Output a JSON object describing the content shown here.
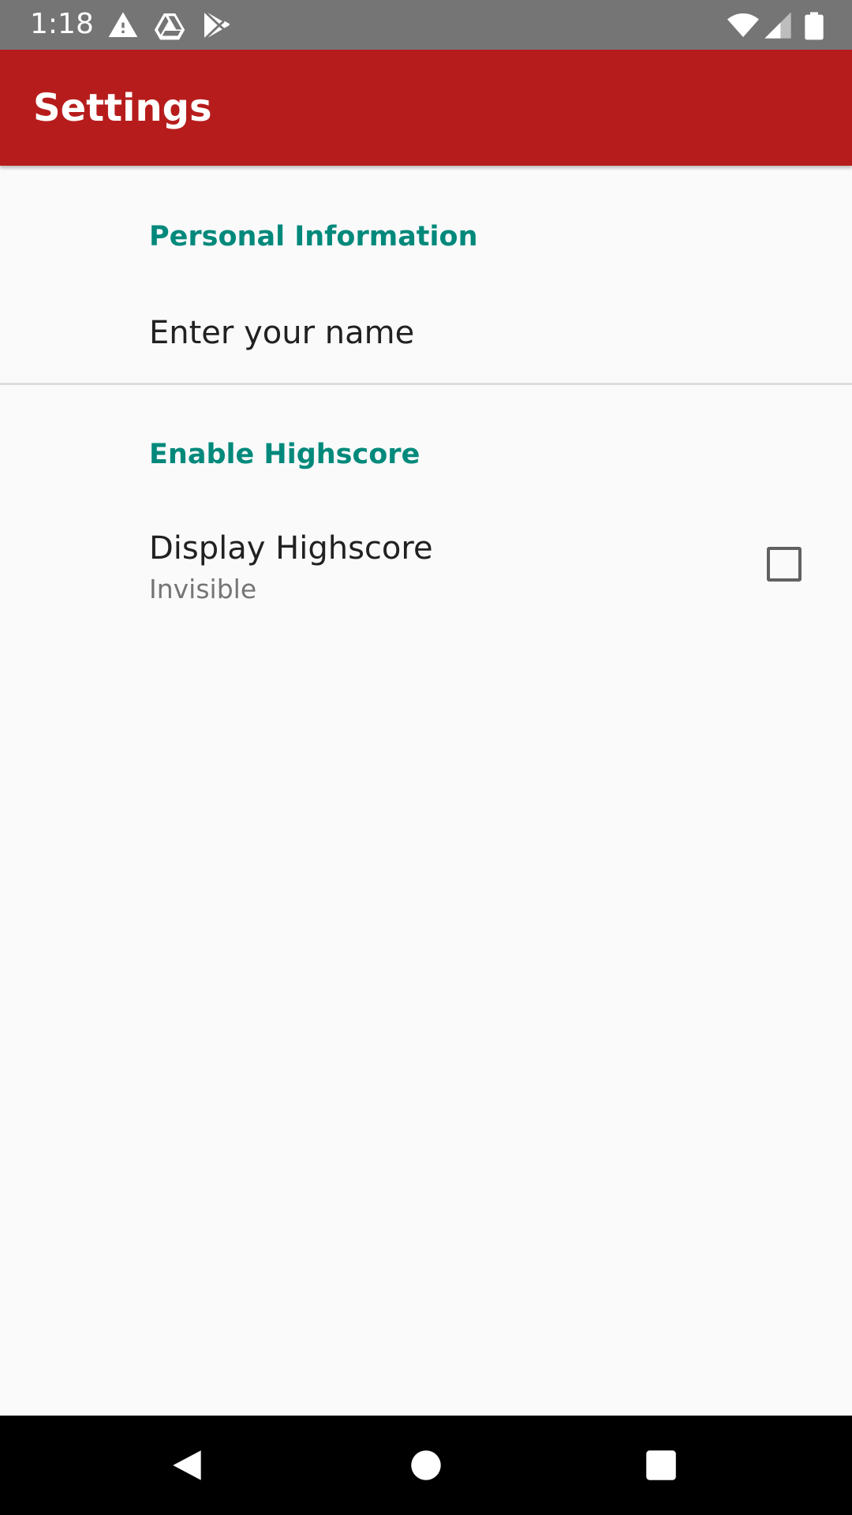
{
  "status_bar": {
    "time": "1:18",
    "icons": [
      "warning-icon",
      "drive-icon",
      "play-store-icon",
      "wifi-icon",
      "cell-signal-icon",
      "battery-icon"
    ]
  },
  "app_bar": {
    "title": "Settings",
    "color": "#b71c1c"
  },
  "preferences": {
    "personal_category": "Personal Information",
    "name_pref_title": "Enter your name",
    "highscore_category": "Enable Highscore",
    "display_highscore_title": "Display Highscore",
    "display_highscore_summary": "Invisible",
    "display_highscore_checked": false
  },
  "colors": {
    "accent": "#00897b",
    "status_bar": "#757575",
    "background": "#fafafa"
  },
  "nav_bar": {
    "icons": [
      "back-icon",
      "home-icon",
      "recents-icon"
    ]
  }
}
